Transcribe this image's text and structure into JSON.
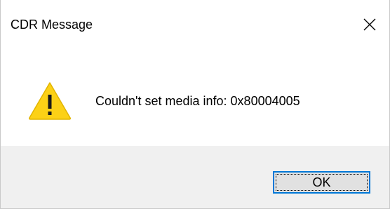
{
  "dialog": {
    "title": "CDR Message",
    "message": "Couldn't set media info: 0x80004005",
    "icon": "warning-icon",
    "buttons": {
      "ok_label": "OK"
    },
    "colors": {
      "warning_fill": "#fcd116",
      "focus_border": "#0078d7",
      "footer_background": "#f0f0f0"
    }
  }
}
